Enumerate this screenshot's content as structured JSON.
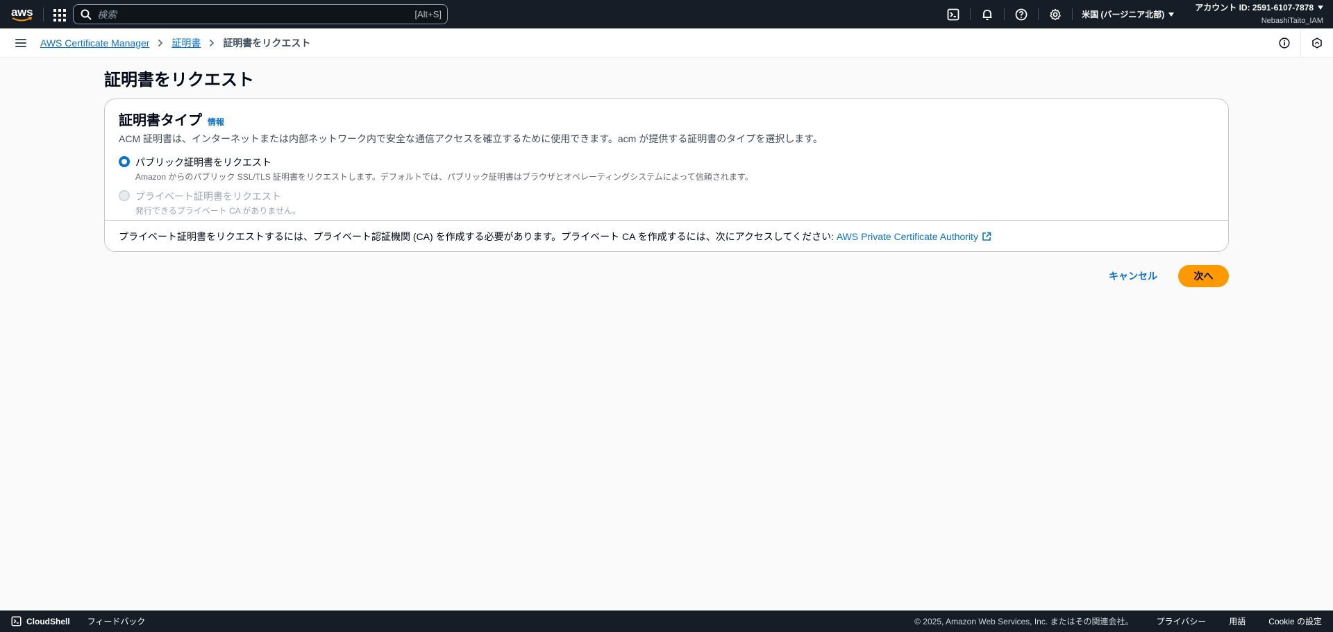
{
  "topnav": {
    "logo_text": "aws",
    "search_placeholder": "検索",
    "search_shortcut": "[Alt+S]",
    "region": "米国 (バージニア北部)",
    "account_id": "アカウント ID: 2591-6107-7878",
    "username": "NebashiTaito_IAM",
    "icons": [
      "cloudshell-icon",
      "bell-icon",
      "help-icon",
      "gear-icon"
    ]
  },
  "breadcrumb": {
    "items": [
      "AWS Certificate Manager",
      "証明書"
    ],
    "current": "証明書をリクエスト"
  },
  "page": {
    "title": "証明書をリクエスト"
  },
  "cert_type": {
    "title": "証明書タイプ",
    "info": "情報",
    "description": "ACM 証明書は、インターネットまたは内部ネットワーク内で安全な通信アクセスを確立するために使用できます。acm が提供する証明書のタイプを選択します。",
    "options": [
      {
        "label": "パブリック証明書をリクエスト",
        "desc": "Amazon からのパブリック SSL/TLS 証明書をリクエストします。デフォルトでは、パブリック証明書はブラウザとオペレーティングシステムによって信頼されます。",
        "selected": true,
        "disabled": false
      },
      {
        "label": "プライベート証明書をリクエスト",
        "desc": "発行できるプライベート CA がありません。",
        "selected": false,
        "disabled": true
      }
    ],
    "footer_text": "プライベート証明書をリクエストするには、プライベート認証機関 (CA) を作成する必要があります。プライベート CA を作成するには、次にアクセスしてください: ",
    "footer_link": "AWS Private Certificate Authority"
  },
  "actions": {
    "cancel": "キャンセル",
    "next": "次へ"
  },
  "footer": {
    "cloudshell": "CloudShell",
    "feedback": "フィードバック",
    "copyright": "© 2025, Amazon Web Services, Inc. またはその関連会社。",
    "privacy": "プライバシー",
    "terms": "用語",
    "cookies": "Cookie の設定"
  },
  "colors": {
    "nav_bg": "#161d26",
    "link": "#0972d3",
    "primary_button": "#ff9900"
  }
}
